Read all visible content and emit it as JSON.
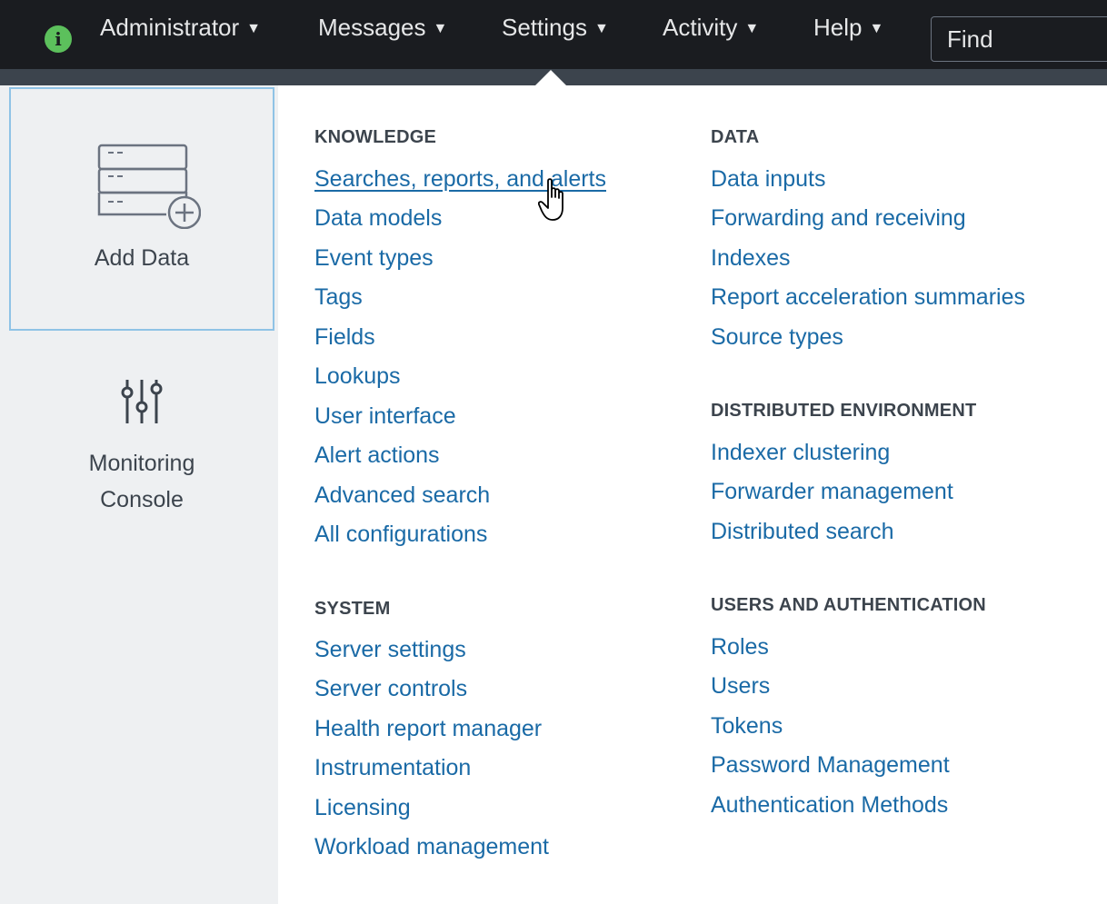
{
  "topbar": {
    "user_menu": "Administrator",
    "messages": "Messages",
    "settings": "Settings",
    "activity": "Activity",
    "help": "Help",
    "find_placeholder": "Find",
    "caret": "▼",
    "info_glyph": "i"
  },
  "sidebar": {
    "add_data_label": "Add Data",
    "monitoring_line1": "Monitoring",
    "monitoring_line2": "Console"
  },
  "knowledge": {
    "heading": "KNOWLEDGE",
    "items": [
      "Searches, reports, and alerts",
      "Data models",
      "Event types",
      "Tags",
      "Fields",
      "Lookups",
      "User interface",
      "Alert actions",
      "Advanced search",
      "All configurations"
    ]
  },
  "system": {
    "heading": "SYSTEM",
    "items": [
      "Server settings",
      "Server controls",
      "Health report manager",
      "Instrumentation",
      "Licensing",
      "Workload management"
    ]
  },
  "data": {
    "heading": "DATA",
    "items": [
      "Data inputs",
      "Forwarding and receiving",
      "Indexes",
      "Report acceleration summaries",
      "Source types"
    ]
  },
  "distributed": {
    "heading": "DISTRIBUTED ENVIRONMENT",
    "items": [
      "Indexer clustering",
      "Forwarder management",
      "Distributed search"
    ]
  },
  "users_auth": {
    "heading": "USERS AND AUTHENTICATION",
    "items": [
      "Roles",
      "Users",
      "Tokens",
      "Password Management",
      "Authentication Methods"
    ]
  },
  "colors": {
    "topbar_bg": "#1a1c20",
    "link": "#1a6aa6",
    "info_badge": "#5cc05c",
    "tile_border": "#8fc3e6"
  },
  "icons": {
    "info": "info-icon",
    "add_data": "add-data-icon",
    "monitoring": "sliders-icon",
    "cursor": "pointer-hand-icon"
  }
}
